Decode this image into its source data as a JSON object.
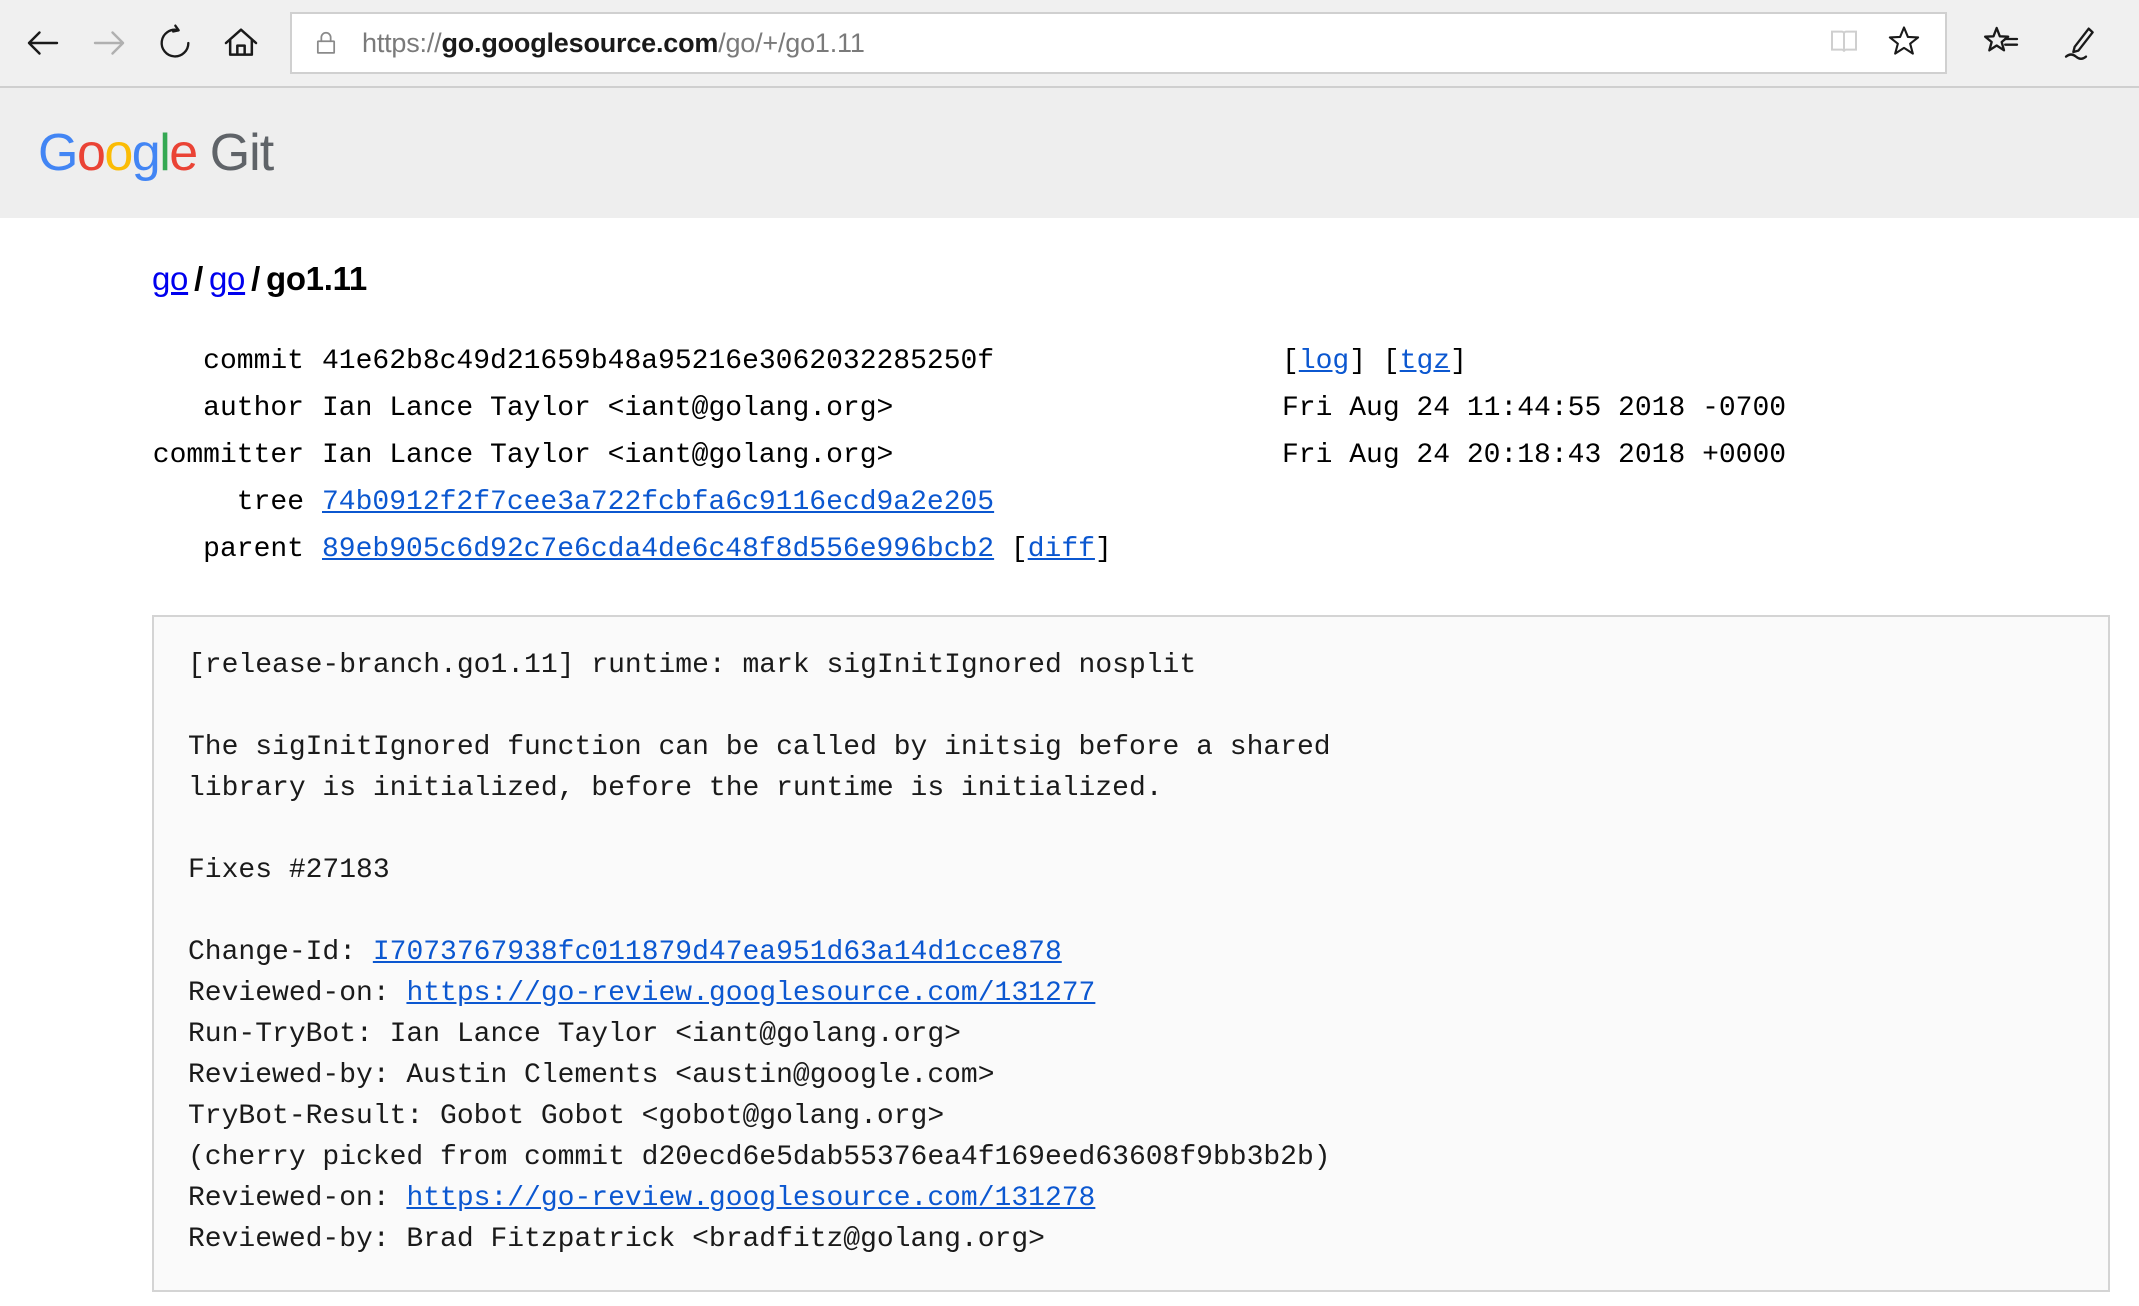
{
  "browser": {
    "back_icon": "back-arrow-icon",
    "forward_icon": "forward-arrow-icon",
    "refresh_icon": "refresh-icon",
    "home_icon": "home-icon",
    "lock_icon": "lock-icon",
    "url_scheme": "https://",
    "url_host": "go.googlesource.com",
    "url_path": "/go/+/go1.11",
    "url_full": "https://go.googlesource.com/go/+/go1.11",
    "reading_view_icon": "book-icon",
    "favorite_icon": "star-icon",
    "hub_icon": "star-list-icon",
    "web_note_icon": "pen-icon"
  },
  "header": {
    "logo_google": [
      "G",
      "o",
      "o",
      "g",
      "l",
      "e"
    ],
    "logo_suffix": "Git",
    "colors": {
      "blue": "#4285f4",
      "red": "#ea4335",
      "yellow": "#fbbc05",
      "green": "#34a853",
      "gray": "#5f6368"
    }
  },
  "breadcrumb": {
    "repo": "go",
    "project": "go",
    "ref": "go1.11",
    "separator": "/"
  },
  "commit": {
    "rows": [
      {
        "label": "commit",
        "value": "41e62b8c49d21659b48a95216e3062032285250f",
        "link": false,
        "extra_open": "[",
        "extra_links": [
          "log",
          "tgz"
        ],
        "extra_close": "]"
      },
      {
        "label": "author",
        "value": "Ian Lance Taylor <iant@golang.org>",
        "link": false,
        "date": "Fri Aug 24 11:44:55 2018 -0700"
      },
      {
        "label": "committer",
        "value": "Ian Lance Taylor <iant@golang.org>",
        "link": false,
        "date": "Fri Aug 24 20:18:43 2018 +0000"
      },
      {
        "label": "tree",
        "value": "74b0912f2f7cee3a722fcbfa6c9116ecd9a2e205",
        "link": true
      },
      {
        "label": "parent",
        "value": "89eb905c6d92c7e6cda4de6c48f8d556e996bcb2",
        "link": true,
        "diff_label": "diff"
      }
    ],
    "log_label": "log",
    "tgz_label": "tgz",
    "diff_label": "diff"
  },
  "message": {
    "subject": "[release-branch.go1.11] runtime: mark sigInitIgnored nosplit",
    "body_line_1": "The sigInitIgnored function can be called by initsig before a shared",
    "body_line_2": "library is initialized, before the runtime is initialized.",
    "fixes": "Fixes #27183",
    "change_id_label": "Change-Id: ",
    "change_id": "I7073767938fc011879d47ea951d63a14d1cce878",
    "reviewed_on_label_1": "Reviewed-on: ",
    "reviewed_on_1": "https://go-review.googlesource.com/131277",
    "run_trybot": "Run-TryBot: Ian Lance Taylor <iant@golang.org>",
    "reviewed_by_1": "Reviewed-by: Austin Clements <austin@google.com>",
    "trybot_result": "TryBot-Result: Gobot Gobot <gobot@golang.org>",
    "cherry_pick": "(cherry picked from commit d20ecd6e5dab55376ea4f169eed63608f9bb3b2b)",
    "reviewed_on_label_2": "Reviewed-on: ",
    "reviewed_on_2": "https://go-review.googlesource.com/131278",
    "reviewed_by_2": "Reviewed-by: Brad Fitzpatrick <bradfitz@golang.org>"
  }
}
